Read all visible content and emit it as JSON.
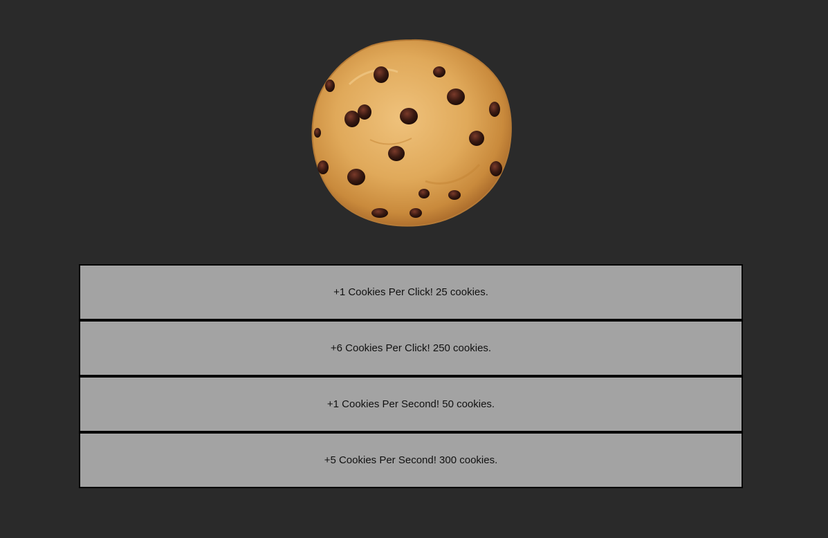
{
  "cookie": {
    "icon": "chocolate-chip-cookie-icon",
    "dough_color": "#e0a95a",
    "chip_color": "#3a1a12"
  },
  "colors": {
    "background": "#2a2a2a",
    "upgrade_bg": "#a3a3a3",
    "upgrade_border": "#000000"
  },
  "upgrades": [
    {
      "label": "+1 Cookies Per Click! 25 cookies."
    },
    {
      "label": "+6 Cookies Per Click! 250 cookies."
    },
    {
      "label": "+1 Cookies Per Second! 50 cookies."
    },
    {
      "label": "+5 Cookies Per Second! 300 cookies."
    }
  ]
}
